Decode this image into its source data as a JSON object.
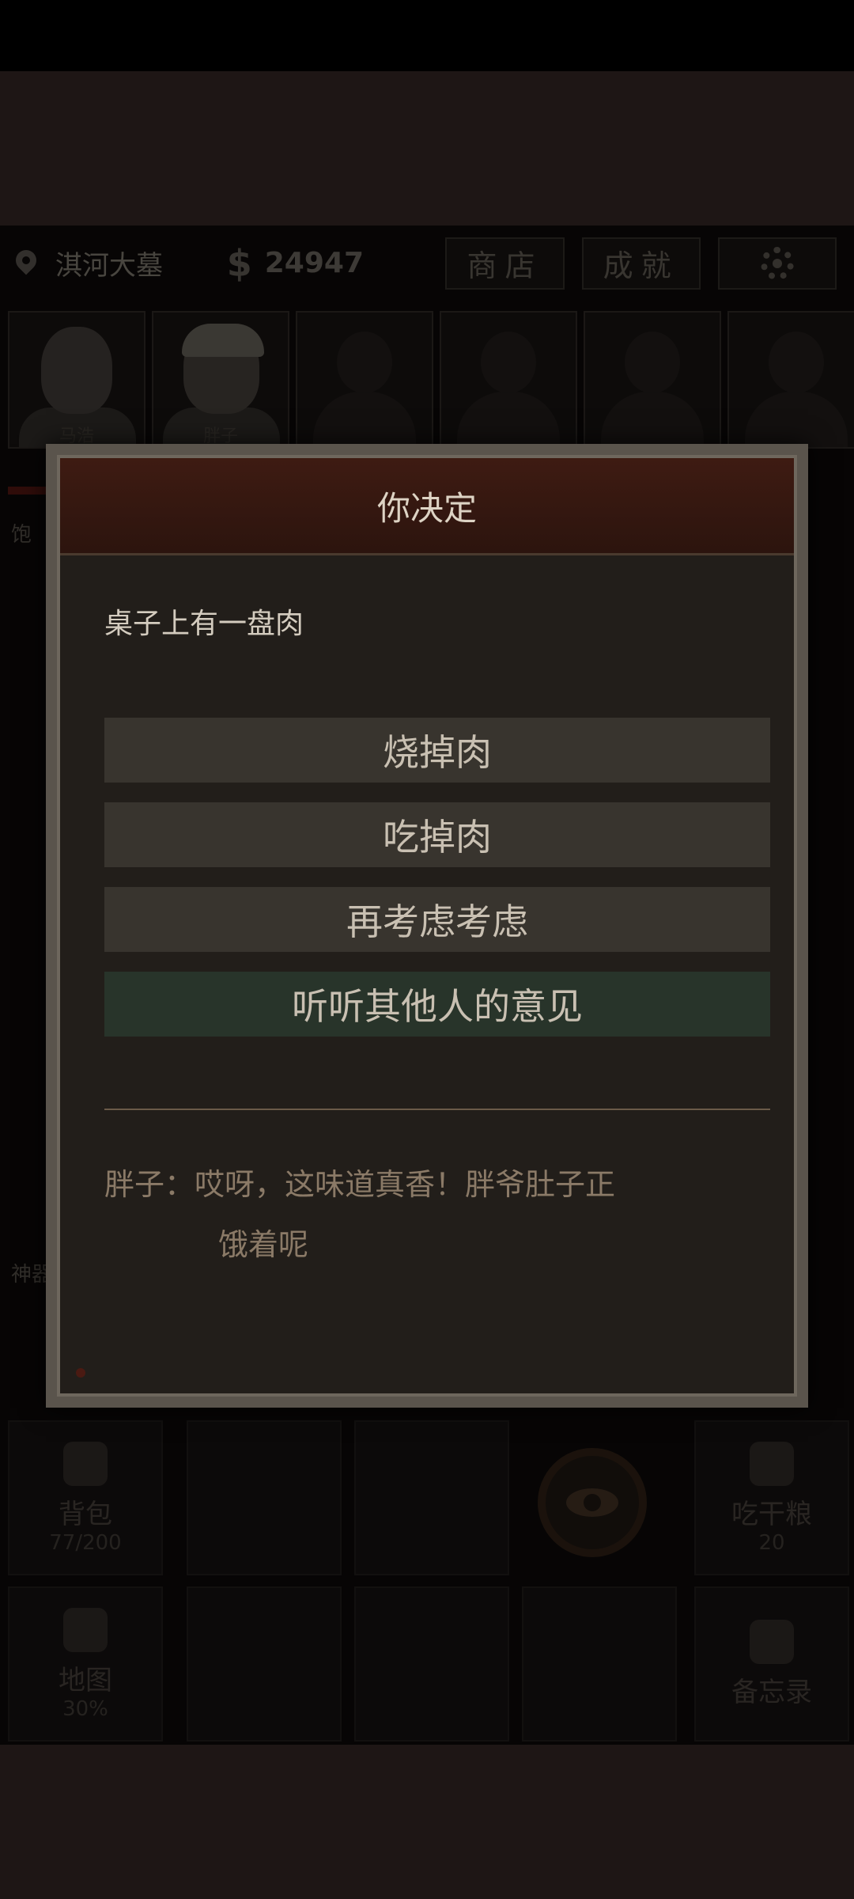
{
  "status": {
    "location": "淇河大墓",
    "money": "24947",
    "shop_label": "商店",
    "achievements_label": "成就",
    "settings_icon": "gear-icon"
  },
  "portraits": [
    {
      "name": "马浩"
    },
    {
      "name": "胖子"
    },
    {
      "name": ""
    },
    {
      "name": ""
    },
    {
      "name": ""
    },
    {
      "name": ""
    }
  ],
  "side": {
    "hunger_label": "饱",
    "artifact_label": "神器"
  },
  "bottom": {
    "backpack_label": "背包",
    "backpack_count": "77/200",
    "eat_label": "吃干粮",
    "eat_count": "20",
    "map_label": "地图",
    "map_percent": "30%",
    "memo_label": "备忘录"
  },
  "dialog": {
    "title": "你决定",
    "description": "桌子上有一盘肉",
    "options": [
      "烧掉肉",
      "吃掉肉",
      "再考虑考虑",
      "听听其他人的意见"
    ],
    "message_line1": "胖子：哎呀，这味道真香！胖爷肚子正",
    "message_line2": "饿着呢"
  },
  "colors": {
    "dialog_header": "#3e1b12",
    "option_bg": "#38342e",
    "option_highlight": "#28342a",
    "message_text": "#8b7a67"
  }
}
